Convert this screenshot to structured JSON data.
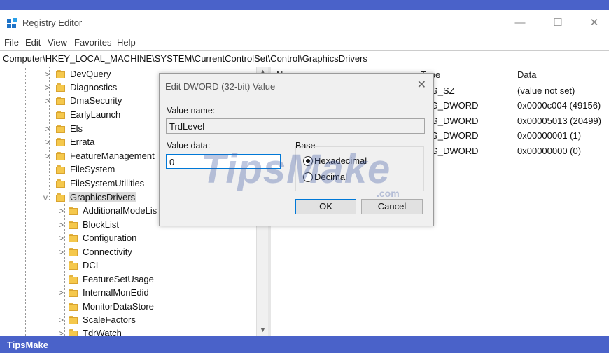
{
  "window": {
    "title": "Registry Editor",
    "controls": {
      "minimize": "—",
      "maximize": "☐",
      "close": "✕"
    }
  },
  "menu": [
    "File",
    "Edit",
    "View",
    "Favorites",
    "Help"
  ],
  "address": "Computer\\HKEY_LOCAL_MACHINE\\SYSTEM\\CurrentControlSet\\Control\\GraphicsDrivers",
  "tree": {
    "items": [
      {
        "label": "DevQuery",
        "chevron": ">"
      },
      {
        "label": "Diagnostics",
        "chevron": ">"
      },
      {
        "label": "DmaSecurity",
        "chevron": ">"
      },
      {
        "label": "EarlyLaunch",
        "chevron": ""
      },
      {
        "label": "Els",
        "chevron": ">"
      },
      {
        "label": "Errata",
        "chevron": ">"
      },
      {
        "label": "FeatureManagement",
        "chevron": ">"
      },
      {
        "label": "FileSystem",
        "chevron": ""
      },
      {
        "label": "FileSystemUtilities",
        "chevron": ""
      },
      {
        "label": "GraphicsDrivers",
        "chevron": "v"
      },
      {
        "label": "AdditionalModeLis",
        "chevron": ">"
      },
      {
        "label": "BlockList",
        "chevron": ">"
      },
      {
        "label": "Configuration",
        "chevron": ">"
      },
      {
        "label": "Connectivity",
        "chevron": ">"
      },
      {
        "label": "DCI",
        "chevron": ""
      },
      {
        "label": "FeatureSetUsage",
        "chevron": ""
      },
      {
        "label": "InternalMonEdid",
        "chevron": ">"
      },
      {
        "label": "MonitorDataStore",
        "chevron": ""
      },
      {
        "label": "ScaleFactors",
        "chevron": ">"
      },
      {
        "label": "TdrWatch",
        "chevron": ">"
      }
    ]
  },
  "list": {
    "headers": {
      "name": "N",
      "type": "Type",
      "data": "Data"
    },
    "rows": [
      {
        "type": "EG_SZ",
        "data": "(value not set)"
      },
      {
        "type": "EG_DWORD",
        "data": "0x0000c004 (49156)"
      },
      {
        "type": "EG_DWORD",
        "data": "0x00005013 (20499)"
      },
      {
        "type": "EG_DWORD",
        "data": "0x00000001 (1)"
      },
      {
        "type": "EG_DWORD",
        "data": "0x00000000 (0)"
      }
    ]
  },
  "dialog": {
    "title": "Edit DWORD (32-bit) Value",
    "value_name_label": "Value name:",
    "value_name": "TrdLevel",
    "value_data_label": "Value data:",
    "value_data": "0",
    "base_label": "Base",
    "hex_label": "Hexadecimal",
    "dec_label": "Decimal",
    "selected_base": "Hexadecimal",
    "ok_label": "OK",
    "cancel_label": "Cancel"
  },
  "watermark": {
    "main": "TipsMake",
    "suffix": ".com"
  },
  "footer": {
    "brand": "TipsMake"
  },
  "colors": {
    "accent": "#4a62c9",
    "folder": "#f5c84c",
    "selection": "#0078d7"
  }
}
